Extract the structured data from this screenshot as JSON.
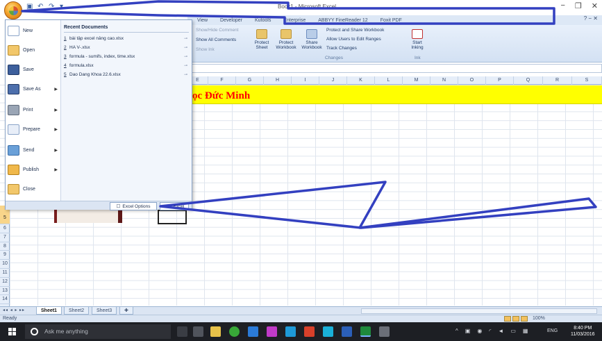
{
  "window": {
    "title": "Book1 - Microsoft Excel",
    "controls": [
      "−",
      "❐",
      "✕"
    ]
  },
  "qat": {
    "icons": [
      "save-icon",
      "undo-icon",
      "redo-icon",
      "customize-icon"
    ]
  },
  "ribbon": {
    "tabs": [
      "View",
      "Developer",
      "Kutools",
      "Enterprise",
      "ABBYY FineReader 12",
      "Foxit PDF"
    ],
    "help_icon": "help-icon",
    "show_hide_comment": "Show/Hide Comment",
    "show_all_comments": "Show All Comments",
    "show_ink": "Show Ink",
    "protect_sheet": "Protect Sheet",
    "protect_workbook": "Protect Workbook",
    "share_workbook": "Share Workbook",
    "protect_share": "Protect and Share Workbook",
    "allow_users": "Allow Users to Edit Ranges",
    "track_changes": "Track Changes",
    "start_inking": "Start Inking",
    "group_changes": "Changes",
    "group_ink": "Ink"
  },
  "sheet": {
    "columns": [
      "E",
      "F",
      "G",
      "H",
      "I",
      "J",
      "K",
      "L",
      "M",
      "N",
      "O",
      "P",
      "Q",
      "R",
      "S"
    ],
    "rows": [
      "5",
      "6",
      "7",
      "8",
      "9",
      "10",
      "11",
      "12",
      "13",
      "14"
    ],
    "heading": "ọc Đức Minh",
    "heading_color": "#ff0000",
    "fill_color": "#ffff00"
  },
  "office_menu": {
    "items": [
      {
        "label": "New",
        "icon": "new-document-icon"
      },
      {
        "label": "Open",
        "icon": "open-folder-icon"
      },
      {
        "label": "Save",
        "icon": "save-icon"
      },
      {
        "label": "Save As",
        "icon": "save-as-icon"
      },
      {
        "label": "Print",
        "icon": "print-icon"
      },
      {
        "label": "Prepare",
        "icon": "prepare-icon"
      },
      {
        "label": "Send",
        "icon": "send-icon"
      },
      {
        "label": "Publish",
        "icon": "publish-icon"
      },
      {
        "label": "Close",
        "icon": "close-folder-icon"
      }
    ],
    "recent_title": "Recent Documents",
    "recent": [
      {
        "num": "1",
        "name": "bài tập excel nâng cao.xlsx"
      },
      {
        "num": "2",
        "name": "HA V-.xlsx"
      },
      {
        "num": "3",
        "name": "formula - sumifs, index, time.xlsx"
      },
      {
        "num": "4",
        "name": "formula.xlsx"
      },
      {
        "num": "5",
        "name": "Dao Dang Khoa 22.6.xlsx"
      }
    ],
    "options_label": "Excel Options",
    "exit_label": "Exit Excel"
  },
  "sheet_tabs": [
    "Sheet1",
    "Sheet2",
    "Sheet3"
  ],
  "status": {
    "ready": "Ready",
    "zoom": "100%"
  },
  "taskbar": {
    "search_placeholder": "Ask me anything",
    "lang": "ENG",
    "time": "8:40 PM",
    "date": "11/03/2016"
  },
  "annotation_color": "#3340c0"
}
